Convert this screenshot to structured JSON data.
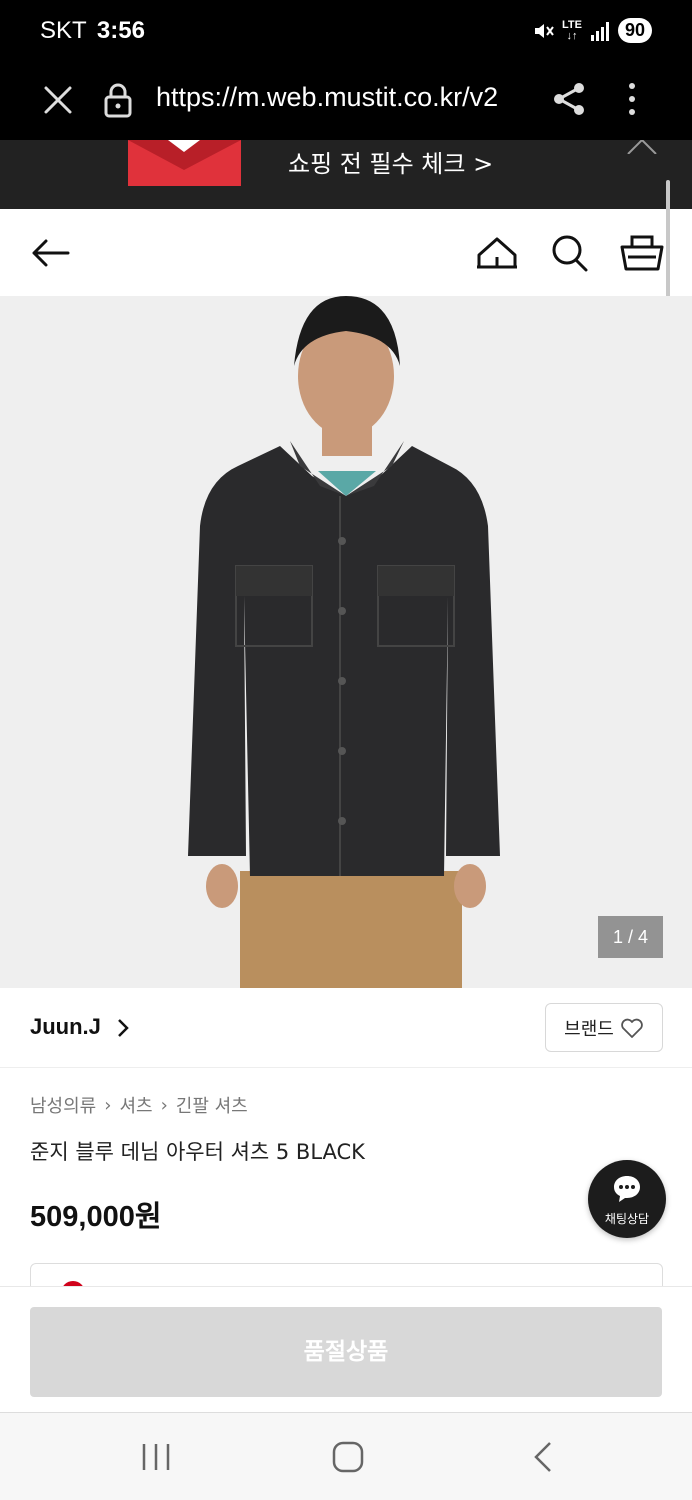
{
  "status_bar": {
    "carrier": "SKT",
    "time": "3:56",
    "network": "LTE",
    "battery": "90"
  },
  "browser": {
    "url": "https://m.web.mustit.co.kr/v2"
  },
  "promo": {
    "text": "쇼핑 전 필수 체크 >"
  },
  "gallery": {
    "counter": "1 / 4"
  },
  "brand": {
    "name": "Juun.J",
    "button_label": "브랜드"
  },
  "breadcrumb": [
    "남성의류",
    "셔츠",
    "긴팔 셔츠"
  ],
  "product": {
    "title": "준지 블루 데님 아우터 셔츠 5 BLACK",
    "price": "509,000원"
  },
  "chat": {
    "label": "채팅상담"
  },
  "action": {
    "soldout_label": "품절상품"
  },
  "colors": {
    "accent": "#e0323b",
    "soldout": "#d8d8d8",
    "chat": "#1c1c1c"
  }
}
